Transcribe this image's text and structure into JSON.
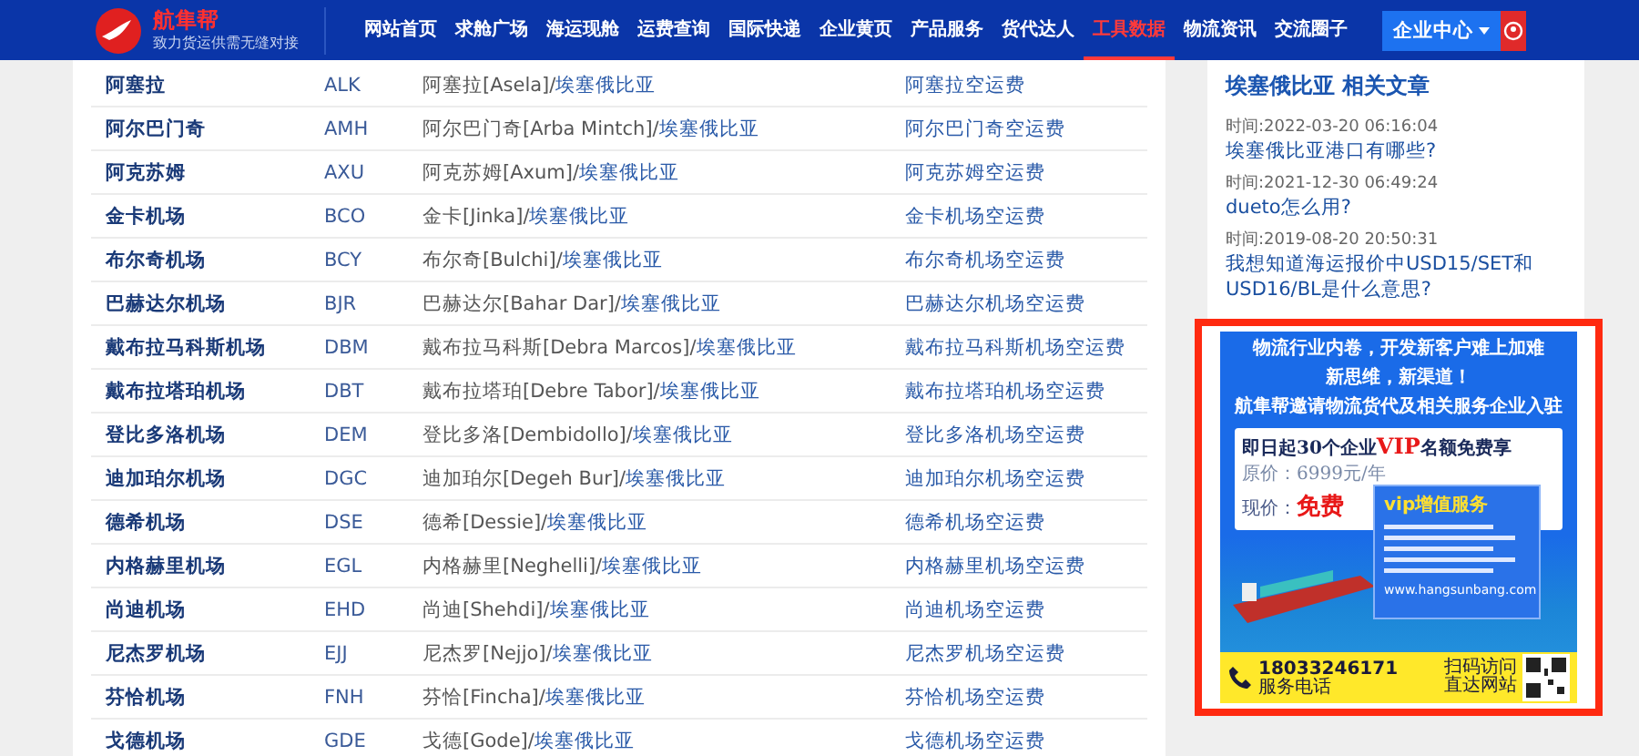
{
  "header": {
    "brand": "航隼帮",
    "tagline": "致力货运供需无缝对接",
    "nav": [
      {
        "label": "网站首页",
        "selected": false
      },
      {
        "label": "求舱广场",
        "selected": false
      },
      {
        "label": "海运现舱",
        "selected": false
      },
      {
        "label": "运费查询",
        "selected": false
      },
      {
        "label": "国际快递",
        "selected": false
      },
      {
        "label": "企业黄页",
        "selected": false
      },
      {
        "label": "产品服务",
        "selected": false
      },
      {
        "label": "货代达人",
        "selected": false
      },
      {
        "label": "工具数据",
        "selected": true
      },
      {
        "label": "物流资讯",
        "selected": false
      },
      {
        "label": "交流圈子",
        "selected": false
      }
    ],
    "user_menu": "企业中心"
  },
  "table": {
    "rows": [
      {
        "name": "阿塞拉",
        "code": "ALK",
        "place": "阿塞拉[Asela]/",
        "country": "埃塞俄比亚",
        "fee": "阿塞拉空运费"
      },
      {
        "name": "阿尔巴门奇",
        "code": "AMH",
        "place": "阿尔巴门奇[Arba Mintch]/",
        "country": "埃塞俄比亚",
        "fee": "阿尔巴门奇空运费"
      },
      {
        "name": "阿克苏姆",
        "code": "AXU",
        "place": "阿克苏姆[Axum]/",
        "country": "埃塞俄比亚",
        "fee": "阿克苏姆空运费"
      },
      {
        "name": "金卡机场",
        "code": "BCO",
        "place": "金卡[Jinka]/",
        "country": "埃塞俄比亚",
        "fee": "金卡机场空运费"
      },
      {
        "name": "布尔奇机场",
        "code": "BCY",
        "place": "布尔奇[Bulchi]/",
        "country": "埃塞俄比亚",
        "fee": "布尔奇机场空运费"
      },
      {
        "name": "巴赫达尔机场",
        "code": "BJR",
        "place": "巴赫达尔[Bahar Dar]/",
        "country": "埃塞俄比亚",
        "fee": "巴赫达尔机场空运费"
      },
      {
        "name": "戴布拉马科斯机场",
        "code": "DBM",
        "place": "戴布拉马科斯[Debra Marcos]/",
        "country": "埃塞俄比亚",
        "fee": "戴布拉马科斯机场空运费"
      },
      {
        "name": "戴布拉塔珀机场",
        "code": "DBT",
        "place": "戴布拉塔珀[Debre Tabor]/",
        "country": "埃塞俄比亚",
        "fee": "戴布拉塔珀机场空运费"
      },
      {
        "name": "登比多洛机场",
        "code": "DEM",
        "place": "登比多洛[Dembidollo]/",
        "country": "埃塞俄比亚",
        "fee": "登比多洛机场空运费"
      },
      {
        "name": "迪加珀尔机场",
        "code": "DGC",
        "place": "迪加珀尔[Degeh Bur]/",
        "country": "埃塞俄比亚",
        "fee": "迪加珀尔机场空运费"
      },
      {
        "name": "德希机场",
        "code": "DSE",
        "place": "德希[Dessie]/",
        "country": "埃塞俄比亚",
        "fee": "德希机场空运费"
      },
      {
        "name": "内格赫里机场",
        "code": "EGL",
        "place": "内格赫里[Neghelli]/",
        "country": "埃塞俄比亚",
        "fee": "内格赫里机场空运费"
      },
      {
        "name": "尚迪机场",
        "code": "EHD",
        "place": "尚迪[Shehdi]/",
        "country": "埃塞俄比亚",
        "fee": "尚迪机场空运费"
      },
      {
        "name": "尼杰罗机场",
        "code": "EJJ",
        "place": "尼杰罗[Nejjo]/",
        "country": "埃塞俄比亚",
        "fee": "尼杰罗机场空运费"
      },
      {
        "name": "芬恰机场",
        "code": "FNH",
        "place": "芬恰[Fincha]/",
        "country": "埃塞俄比亚",
        "fee": "芬恰机场空运费"
      },
      {
        "name": "戈德机场",
        "code": "GDE",
        "place": "戈德[Gode]/",
        "country": "埃塞俄比亚",
        "fee": "戈德机场空运费"
      }
    ]
  },
  "sidebar": {
    "title": "埃塞俄比亚 相关文章",
    "articles": [
      {
        "time": "时间:2022-03-20 06:16:04",
        "title": "埃塞俄比亚港口有哪些?"
      },
      {
        "time": "时间:2021-12-30 06:49:24",
        "title": "dueto怎么用?"
      },
      {
        "time": "时间:2019-08-20 20:50:31",
        "title": "我想知道海运报价中USD15/SET和USD16/BL是什么意思?"
      }
    ]
  },
  "ad": {
    "headline": [
      "物流行业内卷，开发新客户难上加难",
      "新思维，新渠道！",
      "航隼帮邀请物流货代及相关服务企业入驻"
    ],
    "offer_prefix": "即日起30个企业",
    "offer_highlight": "VIP",
    "offer_suffix": "名额免费享",
    "original_price": "原价：6999元/年",
    "current_label": "现价：",
    "current_value": "免费",
    "services_title": "vip增值服务",
    "website": "www.hangsunbang.com",
    "phone": "18033246171",
    "phone_label": "服务电话",
    "qr_caption": [
      "扫码访问",
      "直达网站"
    ]
  }
}
